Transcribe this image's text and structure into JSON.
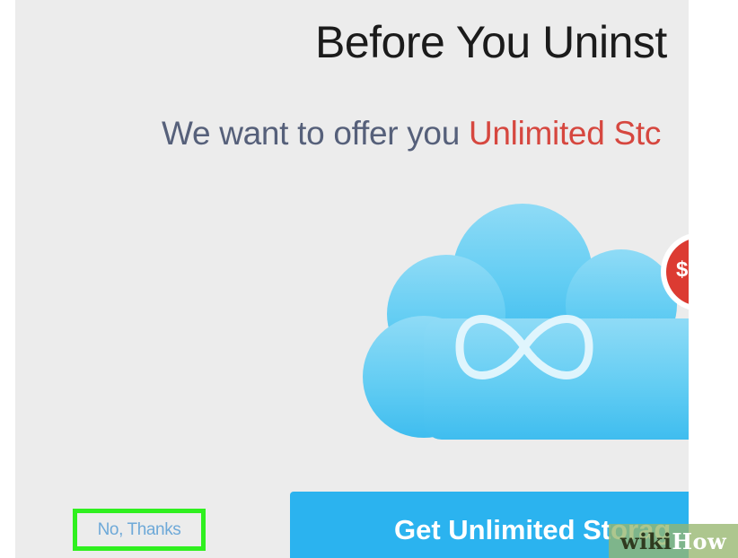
{
  "dialog": {
    "title": "Before You Uninst",
    "offer_prefix": "We want to offer you ",
    "offer_highlight": "Unlimited Stc",
    "badge_symbol": "$",
    "decline_label": "No, Thanks",
    "cta_label": "Get Unlimited Storag"
  },
  "watermark": {
    "part1": "wiki",
    "part2": "How"
  },
  "colors": {
    "panel_bg": "#ececec",
    "highlight": "#d6473f",
    "cta_bg": "#2bb3ef",
    "focus_outline": "#2ff01f",
    "link": "#6ea9d8"
  },
  "icons": {
    "cloud": "cloud-infinity-icon",
    "badge": "dollar-badge-icon"
  }
}
